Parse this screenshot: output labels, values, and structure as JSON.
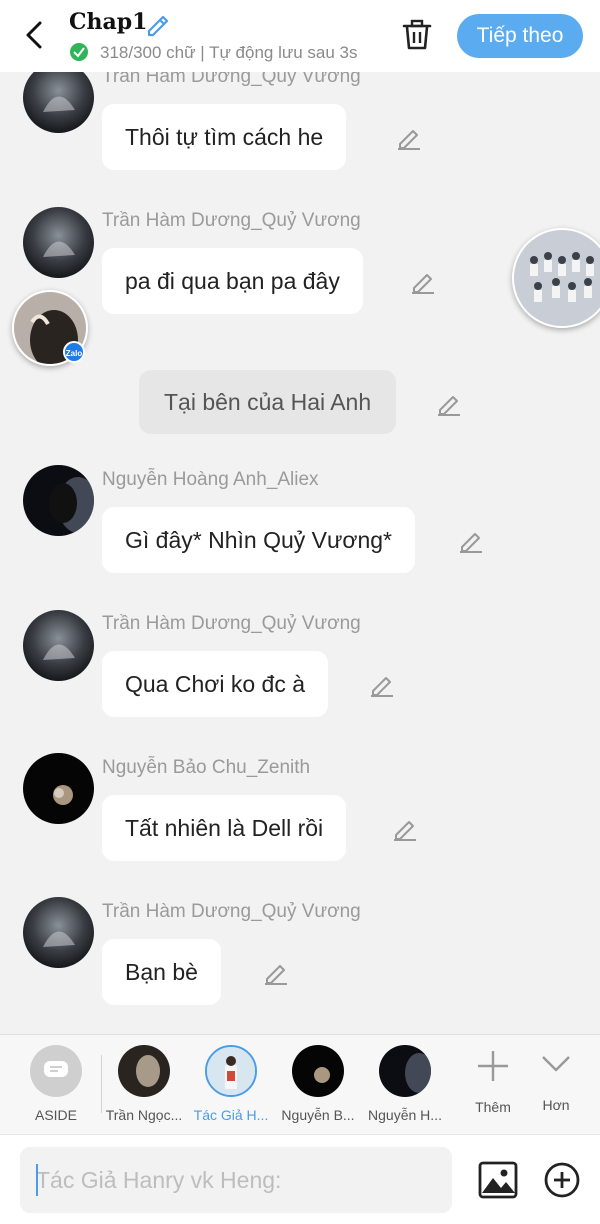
{
  "header": {
    "title": "Chap1",
    "status": "318/300 chữ | Tự động lưu sau 3s",
    "next_label": "Tiếp theo"
  },
  "messages": [
    {
      "name": "Trần Hàm Dương_Quỷ Vương",
      "text": "Thôi tự tìm cách he"
    },
    {
      "name": "Trần Hàm Dương_Quỷ Vương",
      "text": "pa đi qua bạn pa đây"
    },
    {
      "name": "",
      "text": "Tại bên của Hai Anh"
    },
    {
      "name": "Nguyễn Hoàng Anh_Aliex",
      "text": "Gì đây* Nhìn Quỷ Vương*"
    },
    {
      "name": "Trần Hàm Dương_Quỷ Vương",
      "text": "Qua Chơi ko đc à"
    },
    {
      "name": "Nguyễn Bảo Chu_Zenith",
      "text": "Tất nhiên là Dell rồi"
    },
    {
      "name": "Trần Hàm Dương_Quỷ Vương",
      "text": "Bạn bè"
    }
  ],
  "zalo_badge": "Zalo",
  "characters": [
    {
      "label": "ASIDE"
    },
    {
      "label": "Trần Ngọc..."
    },
    {
      "label": "Tác Giả H..."
    },
    {
      "label": "Nguyễn B..."
    },
    {
      "label": "Nguyễn H..."
    },
    {
      "label": "Thêm"
    },
    {
      "label": "Hơn"
    }
  ],
  "composer": {
    "placeholder": "Tác Giả Hanry vk Heng:"
  },
  "colors": {
    "accent": "#5aabf0",
    "active_tab": "#4a9ce8",
    "background": "#f2f2f2"
  }
}
